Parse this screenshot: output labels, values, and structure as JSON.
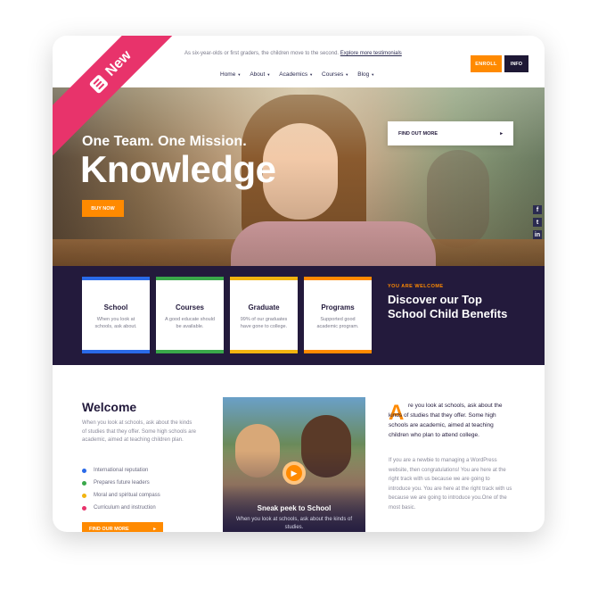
{
  "ribbon": {
    "label": "New"
  },
  "topbar": {
    "announcement": "As six-year-olds or first graders, the children move to the second.",
    "announcement_link": "Explore more testimonials",
    "enroll_label": "ENROLL",
    "info_label": "INFO"
  },
  "nav": {
    "items": [
      "Home",
      "About",
      "Academics",
      "Courses",
      "Blog"
    ]
  },
  "hero": {
    "subtitle": "One Team. One Mission.",
    "title": "Knowledge",
    "cta": "BUY NOW"
  },
  "social": {
    "icons": [
      "facebook-icon",
      "twitter-icon",
      "linkedin-icon"
    ],
    "glyphs": [
      "f",
      "t",
      "in"
    ]
  },
  "features": [
    {
      "title": "School",
      "desc": "When you look at schools, ask about.",
      "color": "#2a6ae8"
    },
    {
      "title": "Courses",
      "desc": "A good educate should be available.",
      "color": "#3aa84a"
    },
    {
      "title": "Graduate",
      "desc": "99% of our graduates have gone to college.",
      "color": "#f2b410"
    },
    {
      "title": "Programs",
      "desc": "Supported good academic program.",
      "color": "#ff8a00"
    }
  ],
  "welcome_block": {
    "eyebrow": "YOU ARE WELCOME",
    "heading": "Discover our Top School Child Benefits",
    "cta": "FIND OUT MORE"
  },
  "welcome": {
    "title": "Welcome",
    "text": "When you look at schools, ask about the kinds of studies that they offer. Some high schools are academic, aimed at teaching children plan.",
    "bullets": [
      {
        "label": "International reputation",
        "color": "#2a6ae8"
      },
      {
        "label": "Prepares future leaders",
        "color": "#3aa84a"
      },
      {
        "label": "Moral and spiritual compass",
        "color": "#f2b410"
      },
      {
        "label": "Curriculum and instruction",
        "color": "#e8336b"
      }
    ],
    "cta": "FIND OUR MORE"
  },
  "video": {
    "title": "Sneak peek to School",
    "subtitle": "When you look at schools, ask about the kinds of studies."
  },
  "right_column": {
    "dropcap": "A",
    "lead": "re you look at schools, ask about the kinds of studies that they offer. Some high schools are academic, aimed at teaching children who plan to attend college.",
    "body": "If you are a newbie to managing a WordPress website, then congratulations! You are here at the right track with us because we are going to introduce you. You are here at the right track with us because we are going to introduce you.One of the most basic."
  },
  "colors": {
    "accent": "#ff8a00",
    "dark": "#231a3c",
    "ribbon": "#e8336b"
  }
}
